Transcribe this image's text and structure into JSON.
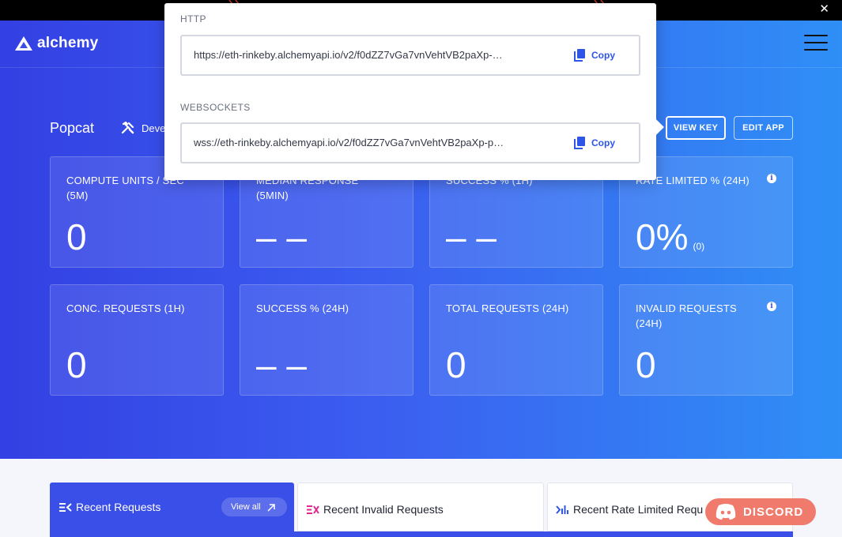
{
  "topbar": {
    "close_symbol": "✕"
  },
  "brand": {
    "name": "alchemy"
  },
  "app": {
    "name": "Popcat",
    "environment": "Deve"
  },
  "actions": {
    "view_key": "VIEW KEY",
    "edit_app": "EDIT APP"
  },
  "popover": {
    "http_label": "HTTP",
    "http_url": "https://eth-rinkeby.alchemyapi.io/v2/f0dZZ7vGa7vnVehtVB2paXp-…",
    "websockets_label": "WEBSOCKETS",
    "ws_url": "wss://eth-rinkeby.alchemyapi.io/v2/f0dZZ7vGa7vnVehtVB2paXp-p…",
    "copy_label": "Copy"
  },
  "metrics": [
    {
      "label": "COMPUTE UNITS / SEC (5M)",
      "value": "0",
      "sub": ""
    },
    {
      "label": "MEDIAN RESPONSE (5MIN)",
      "value": "– –",
      "sub": ""
    },
    {
      "label": "SUCCESS % (1H)",
      "value": "– –",
      "sub": ""
    },
    {
      "label": "RATE LIMITED % (24H)",
      "value": "0%",
      "sub": "(0)"
    },
    {
      "label": "CONC. REQUESTS (1H)",
      "value": "0",
      "sub": ""
    },
    {
      "label": "SUCCESS % (24H)",
      "value": "– –",
      "sub": ""
    },
    {
      "label": "TOTAL REQUESTS (24H)",
      "value": "0",
      "sub": ""
    },
    {
      "label": "INVALID REQUESTS (24H)",
      "value": "0",
      "sub": ""
    }
  ],
  "tabs": {
    "recent": "Recent Requests",
    "view_all": "View all",
    "invalid": "Recent Invalid Requests",
    "rate_limited": "Recent Rate Limited Requ"
  },
  "discord": {
    "label": "DISCORD"
  },
  "colors": {
    "accent": "#3a4fe8",
    "discord": "#f07a6c",
    "hero_start": "#3340e3",
    "hero_end": "#2f8ff6"
  },
  "icons": [
    "close-icon",
    "alchemy-logo-icon",
    "menu-icon",
    "tools-icon",
    "info-icon",
    "copy-icon",
    "requests-icon",
    "arrow-up-right-icon",
    "invalid-icon",
    "rate-limit-icon",
    "discord-icon"
  ]
}
